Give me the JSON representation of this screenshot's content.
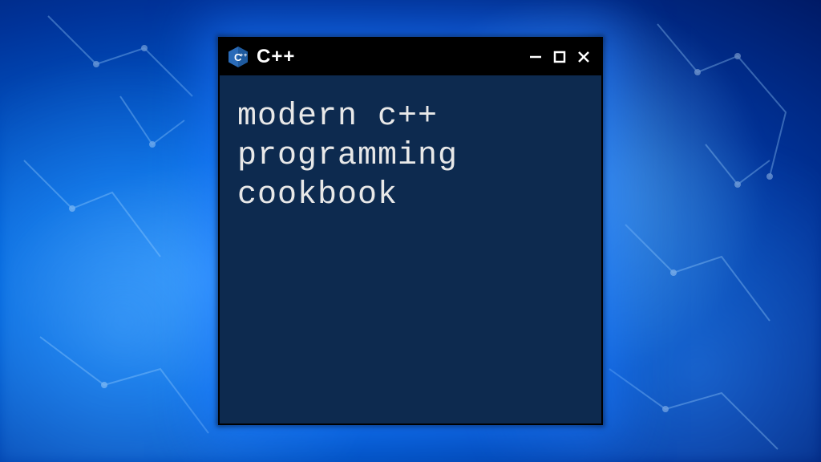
{
  "window": {
    "title": "C++",
    "icon_name": "cpp-icon",
    "controls": {
      "minimize": "−",
      "maximize": "☐",
      "close": "✕"
    }
  },
  "content": {
    "text": "modern c++\nprogramming\ncookbook"
  },
  "colors": {
    "titlebar_bg": "#000000",
    "window_bg": "#0d2a4f",
    "text": "#e8e8e8",
    "accent_blue": "#2a6bb8",
    "icon_inner": "#5e94c9"
  }
}
